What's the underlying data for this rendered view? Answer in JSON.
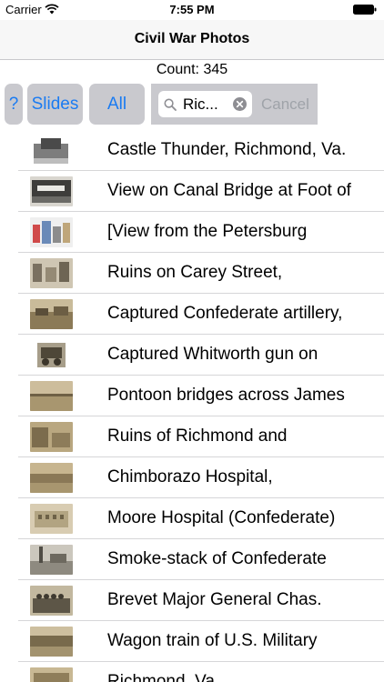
{
  "status_bar": {
    "carrier": "Carrier",
    "time": "7:55 PM"
  },
  "nav": {
    "title": "Civil War Photos"
  },
  "count_label": "Count: 345",
  "toolbar": {
    "help_label": "?",
    "slides_label": "Slides",
    "all_label": "All",
    "search_value": "Ric...",
    "cancel_label": "Cancel"
  },
  "photos": [
    {
      "title": "Castle Thunder, Richmond, Va."
    },
    {
      "title": "View on Canal Bridge at Foot of"
    },
    {
      "title": "[View from the Petersburg"
    },
    {
      "title": "Ruins on Carey Street,"
    },
    {
      "title": "Captured Confederate artillery,"
    },
    {
      "title": "Captured Whitworth gun on"
    },
    {
      "title": "Pontoon bridges across James"
    },
    {
      "title": "Ruins of Richmond and"
    },
    {
      "title": "Chimborazo Hospital,"
    },
    {
      "title": "Moore Hospital (Confederate)"
    },
    {
      "title": "Smoke-stack of Confederate"
    },
    {
      "title": "Brevet Major General Chas."
    },
    {
      "title": "Wagon train of U.S. Military"
    },
    {
      "title": "Richmond, Va."
    }
  ],
  "colors": {
    "accent": "#1a7bf2",
    "toolbar_bg": "#c9c9ce",
    "cancel_disabled": "#9fa3a9"
  }
}
